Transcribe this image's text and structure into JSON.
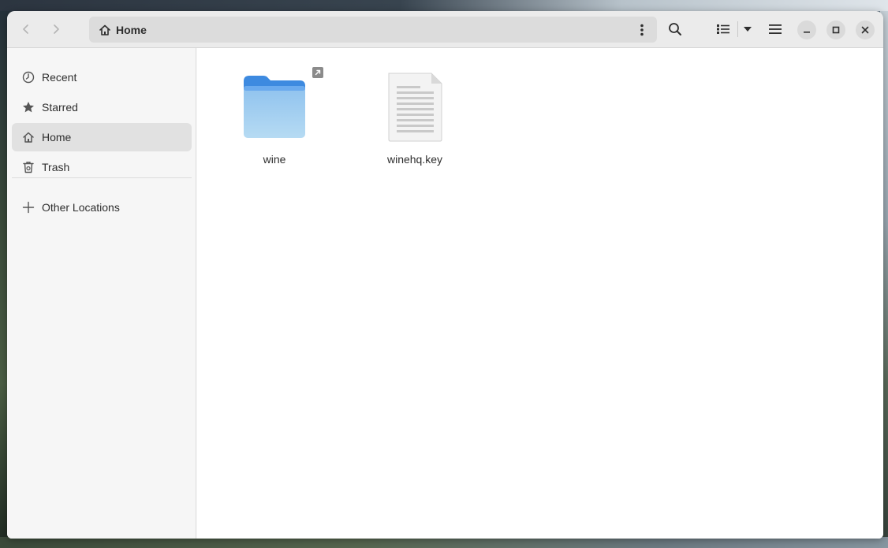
{
  "window": {
    "colors": {
      "accent": "#3584e4",
      "folder_light": "#a8d3f0",
      "folder_dark": "#3d8ae0"
    }
  },
  "headerbar": {
    "back_icon": "chevron-left-icon",
    "forward_icon": "chevron-right-icon",
    "path": {
      "home_icon": "home-icon",
      "label": "Home",
      "menu_icon": "vertical-dots-icon"
    },
    "search_icon": "search-icon",
    "view_icon": "list-view-icon",
    "view_dropdown_icon": "caret-down-icon",
    "menu_icon": "hamburger-icon",
    "minimize_icon": "minimize-icon",
    "maximize_icon": "maximize-icon",
    "close_icon": "close-icon"
  },
  "sidebar": {
    "items": [
      {
        "label": "Recent",
        "icon": "clock-icon"
      },
      {
        "label": "Starred",
        "icon": "star-icon"
      },
      {
        "label": "Home",
        "icon": "home-icon",
        "active": true
      },
      {
        "label": "Trash",
        "icon": "trash-icon"
      }
    ],
    "other": {
      "label": "Other Locations",
      "icon": "plus-icon"
    }
  },
  "files": [
    {
      "name": "wine",
      "type": "folder",
      "symlink": true,
      "icon": "folder-icon"
    },
    {
      "name": "winehq.key",
      "type": "text",
      "icon": "text-file-icon"
    }
  ]
}
